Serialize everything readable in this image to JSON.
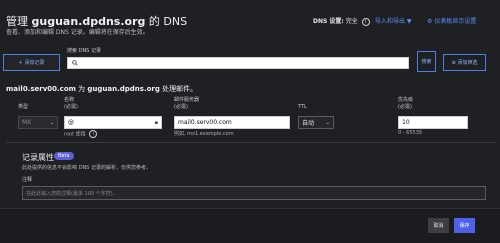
{
  "header": {
    "title_prefix": "管理",
    "domain": "guguan.dpdns.org",
    "title_suffix": "的 DNS",
    "subtitle": "查看、添加和编辑 DNS 记录。编辑将在保存后生效。",
    "dns_setting_label": "DNS 设置:",
    "dns_setting_value": "完全",
    "import_export": "导入和导出 ▼",
    "dashboard_settings": "仪表板显示设置"
  },
  "toolbar": {
    "add_button": "+ 添加记录",
    "search_label": "搜索 DNS 记录",
    "search_placeholder": "",
    "search_button": "搜索",
    "filter_button": "添加筛选"
  },
  "record": {
    "heading_host": "mail0.serv00.com",
    "heading_suffix": "为",
    "heading_domain": "guguan.dpdns.org",
    "heading_tail": "处理邮件。"
  },
  "form": {
    "type_label": "类型",
    "type_value": "MX",
    "name_label": "名称",
    "name_required": "(必需)",
    "name_value": "@",
    "name_hint": "root 使用",
    "mail_label": "邮件服务器",
    "mail_required": "(必需)",
    "mail_value": "mail0.serv00.com",
    "mail_hint": "例如, mx1.example.com",
    "ttl_label": "TTL",
    "ttl_value": "自动",
    "priority_label": "优先级",
    "priority_required": "(必需)",
    "priority_value": "10",
    "priority_hint": "0 - 65535"
  },
  "attributes": {
    "title": "记录属性",
    "beta": "Beta",
    "subtitle": "此处提供的信息不会影响 DNS 记录的解析，仅供您参考。",
    "note_label": "注释",
    "note_placeholder": "在此处输入您的注释(最多 100 个字符)。"
  },
  "footer": {
    "cancel": "取消",
    "save": "保存"
  },
  "colors": {
    "accent": "#4e61ea",
    "link": "#5b8ff9",
    "background": "#1f2023"
  }
}
